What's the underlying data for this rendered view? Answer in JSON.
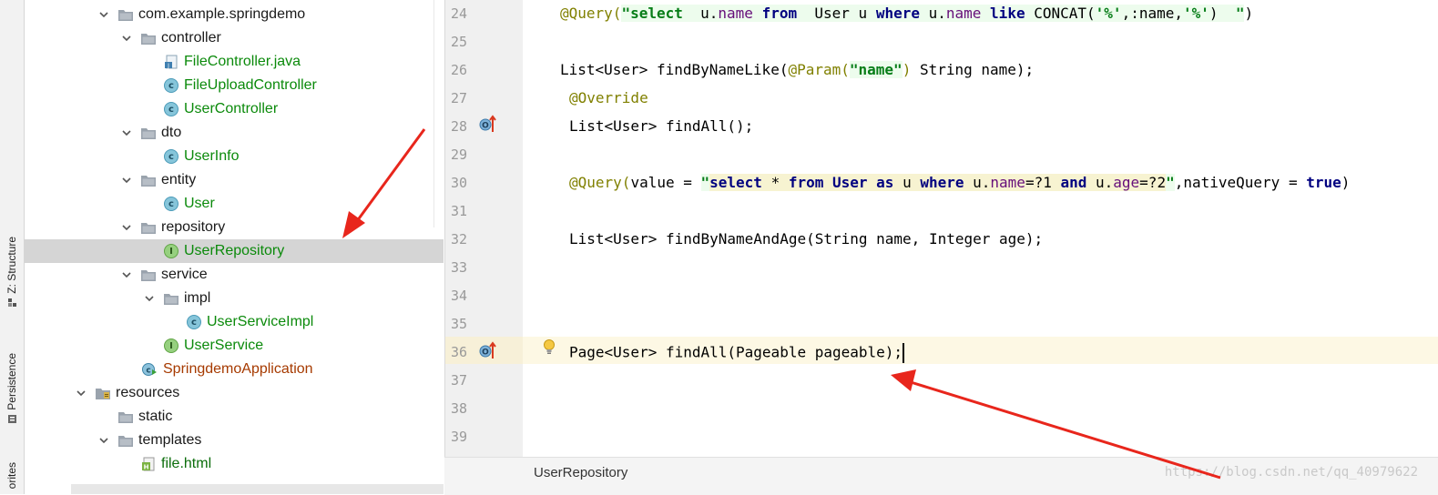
{
  "tool_windows": [
    {
      "label": "Z: Structure",
      "icon": "structure-icon"
    },
    {
      "label": "Persistence",
      "icon": "persistence-icon"
    },
    {
      "label": "orites",
      "icon": "favorites-icon"
    }
  ],
  "tree": [
    {
      "text": "com.example.springdemo",
      "kind": "package",
      "expanded": true,
      "indent": 0
    },
    {
      "text": "controller",
      "kind": "package",
      "expanded": true,
      "indent": 1
    },
    {
      "text": "FileController.java",
      "kind": "java-file",
      "indent": 2
    },
    {
      "text": "FileUploadController",
      "kind": "class",
      "indent": 2
    },
    {
      "text": "UserController",
      "kind": "class",
      "indent": 2
    },
    {
      "text": "dto",
      "kind": "package",
      "expanded": true,
      "indent": 1
    },
    {
      "text": "UserInfo",
      "kind": "class",
      "indent": 2
    },
    {
      "text": "entity",
      "kind": "package",
      "expanded": true,
      "indent": 1
    },
    {
      "text": "User",
      "kind": "class",
      "indent": 2
    },
    {
      "text": "repository",
      "kind": "package",
      "expanded": true,
      "indent": 1
    },
    {
      "text": "UserRepository",
      "kind": "interface",
      "indent": 2,
      "selected": true
    },
    {
      "text": "service",
      "kind": "package",
      "expanded": true,
      "indent": 1
    },
    {
      "text": "impl",
      "kind": "package",
      "expanded": true,
      "indent": 2
    },
    {
      "text": "UserServiceImpl",
      "kind": "class",
      "indent": 3
    },
    {
      "text": "UserService",
      "kind": "interface",
      "indent": 2
    },
    {
      "text": "SpringdemoApplication",
      "kind": "application",
      "indent": 1
    },
    {
      "text": "resources",
      "kind": "resources",
      "expanded": true,
      "indent": -1
    },
    {
      "text": "static",
      "kind": "folder",
      "indent": 0
    },
    {
      "text": "templates",
      "kind": "folder",
      "expanded": true,
      "indent": 0
    },
    {
      "text": "file.html",
      "kind": "html",
      "indent": 1
    }
  ],
  "editor": {
    "line_numbers": [
      "24",
      "25",
      "26",
      "27",
      "28",
      "29",
      "30",
      "31",
      "32",
      "33",
      "34",
      "35",
      "36",
      "37",
      "38",
      "39"
    ],
    "lines": {
      "l24": [
        {
          "c": "ann",
          "t": "@Query("
        },
        {
          "c": "str strbg",
          "t": "\"select  "
        },
        {
          "c": "strbg",
          "t": "u."
        },
        {
          "c": "fld strbg",
          "t": "name "
        },
        {
          "c": "kw strbg",
          "t": "from  "
        },
        {
          "c": "strbg",
          "t": "User u "
        },
        {
          "c": "kw strbg",
          "t": "where "
        },
        {
          "c": "strbg",
          "t": "u."
        },
        {
          "c": "fld strbg",
          "t": "name "
        },
        {
          "c": "kw strbg",
          "t": "like "
        },
        {
          "c": "strbg",
          "t": "CONCAT"
        },
        {
          "c": "strbg",
          "t": "("
        },
        {
          "c": "str strbg",
          "t": "'%'"
        },
        {
          "c": "strbg",
          "t": ",:name,"
        },
        {
          "c": "str strbg",
          "t": "'%'"
        },
        {
          "c": "strbg",
          "t": ")  "
        },
        {
          "c": "str strbg",
          "t": "\""
        },
        {
          "c": "",
          "t": ")"
        }
      ],
      "l26": [
        {
          "c": "",
          "t": "List<User> findByNameLike("
        },
        {
          "c": "ann",
          "t": "@Param("
        },
        {
          "c": "str strbg",
          "t": "\"name\""
        },
        {
          "c": "ann",
          "t": ")"
        },
        {
          "c": "",
          "t": " String name);"
        }
      ],
      "l27": [
        {
          "c": "ann",
          "t": "@Override"
        }
      ],
      "l28": [
        {
          "c": "",
          "t": "List<User> findAll();"
        }
      ],
      "l30": [
        {
          "c": "ann",
          "t": "@Query("
        },
        {
          "c": "",
          "t": "value = "
        },
        {
          "c": "str strbg",
          "t": "\""
        },
        {
          "c": "kw sqlbg",
          "t": "select "
        },
        {
          "c": "sqlbg",
          "t": "* "
        },
        {
          "c": "kw sqlbg",
          "t": "from User as "
        },
        {
          "c": "sqlbg",
          "t": "u "
        },
        {
          "c": "kw sqlbg",
          "t": "where "
        },
        {
          "c": "sqlbg",
          "t": "u."
        },
        {
          "c": "fld sqlbg",
          "t": "name"
        },
        {
          "c": "sqlbg",
          "t": "=?1 "
        },
        {
          "c": "kw sqlbg",
          "t": "and "
        },
        {
          "c": "sqlbg",
          "t": "u."
        },
        {
          "c": "fld sqlbg",
          "t": "age"
        },
        {
          "c": "sqlbg",
          "t": "=?2"
        },
        {
          "c": "str strbg",
          "t": "\""
        },
        {
          "c": "",
          "t": ",nativeQuery = "
        },
        {
          "c": "kw",
          "t": "true"
        },
        {
          "c": "",
          "t": ")"
        }
      ],
      "l32": [
        {
          "c": "",
          "t": "List<User> findByNameAndAge(String name, Integer age);"
        }
      ],
      "l36": [
        {
          "c": "",
          "t": "Page<User> findAll(Pageable pageable);"
        }
      ]
    }
  },
  "breadcrumb": "UserRepository",
  "watermark": "https://blog.csdn.net/qq_40979622",
  "colors": {
    "arrow": "#e8261c",
    "selection": "#d5d5d5",
    "caret_line": "#fdf8e4"
  }
}
